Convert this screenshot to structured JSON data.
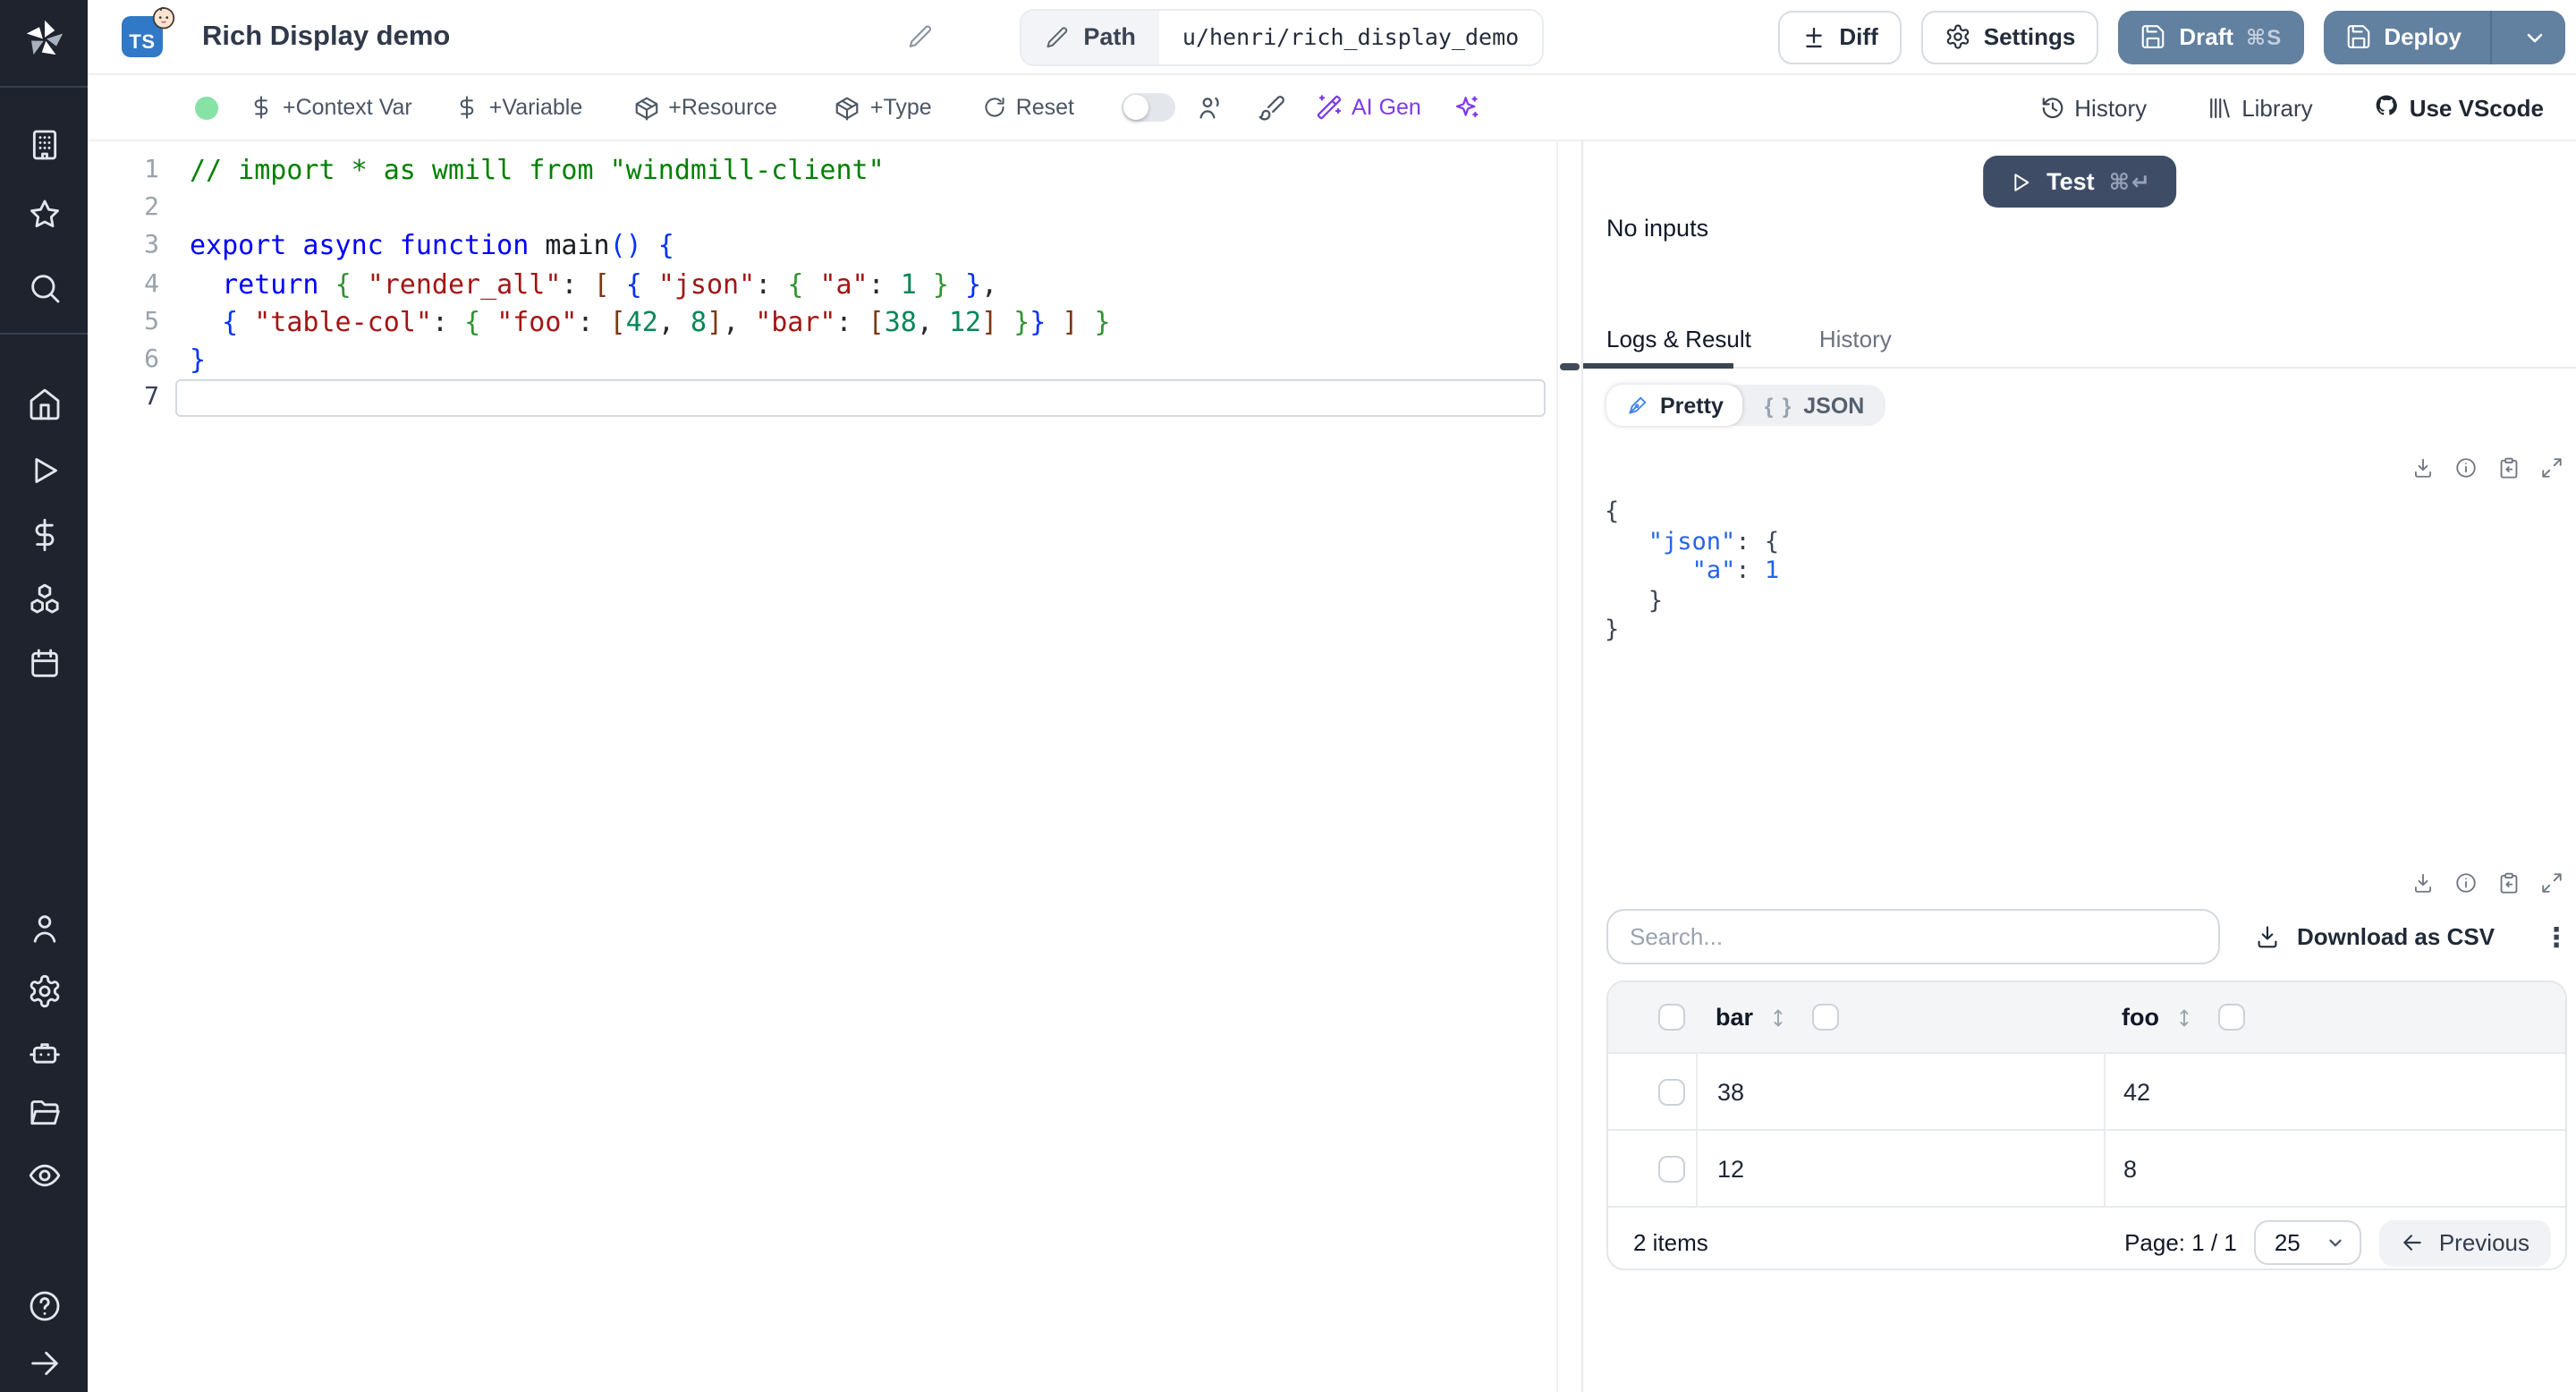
{
  "header": {
    "title": "Rich Display demo",
    "lang_badge": "TS",
    "path": {
      "label": "Path",
      "value": "u/henri/rich_display_demo"
    },
    "buttons": {
      "diff": "Diff",
      "settings": "Settings",
      "draft": "Draft",
      "draft_shortcut": "⌘S",
      "deploy": "Deploy"
    }
  },
  "toolbar": {
    "status_color": "#86e3a5",
    "context_var": "+Context Var",
    "variable": "+Variable",
    "resource": "+Resource",
    "type": "+Type",
    "reset": "Reset",
    "ai_gen": "AI Gen",
    "ai_color": "#7c3aed",
    "history": "History",
    "library": "Library",
    "vscode": "Use VScode"
  },
  "sidebar": {
    "icons": [
      "windmill-logo",
      "building",
      "star",
      "search",
      "home",
      "play",
      "dollar",
      "cubes",
      "calendar",
      "user",
      "gear",
      "bot",
      "folder",
      "eye",
      "help-circle",
      "arrow-right"
    ]
  },
  "editor": {
    "lines": [
      {
        "n": "1",
        "cur": false,
        "tokens": [
          {
            "t": "// import * as wmill from \"windmill-client\"",
            "c": "com"
          }
        ]
      },
      {
        "n": "2",
        "cur": false,
        "tokens": []
      },
      {
        "n": "3",
        "cur": false,
        "tokens": [
          {
            "t": "export async function ",
            "c": "kw"
          },
          {
            "t": "main",
            "c": "fn"
          },
          {
            "t": "() {",
            "c": "b1"
          }
        ]
      },
      {
        "n": "4",
        "cur": false,
        "tokens": [
          {
            "t": "  ",
            "c": "pl"
          },
          {
            "t": "return",
            "c": "kw"
          },
          {
            "t": " ",
            "c": "pl"
          },
          {
            "t": "{ ",
            "c": "b2"
          },
          {
            "t": "\"render_all\"",
            "c": "str"
          },
          {
            "t": ": ",
            "c": "pl"
          },
          {
            "t": "[ ",
            "c": "b3"
          },
          {
            "t": "{ ",
            "c": "b1"
          },
          {
            "t": "\"json\"",
            "c": "str"
          },
          {
            "t": ": ",
            "c": "pl"
          },
          {
            "t": "{ ",
            "c": "b2"
          },
          {
            "t": "\"a\"",
            "c": "str"
          },
          {
            "t": ": ",
            "c": "pl"
          },
          {
            "t": "1",
            "c": "num"
          },
          {
            "t": " }",
            "c": "b2"
          },
          {
            "t": " }",
            "c": "b1"
          },
          {
            "t": ",",
            "c": "pl"
          }
        ]
      },
      {
        "n": "5",
        "cur": false,
        "tokens": [
          {
            "t": "  ",
            "c": "pl"
          },
          {
            "t": "{ ",
            "c": "b1"
          },
          {
            "t": "\"table-col\"",
            "c": "str"
          },
          {
            "t": ": ",
            "c": "pl"
          },
          {
            "t": "{ ",
            "c": "b2"
          },
          {
            "t": "\"foo\"",
            "c": "str"
          },
          {
            "t": ": ",
            "c": "pl"
          },
          {
            "t": "[",
            "c": "b3"
          },
          {
            "t": "42",
            "c": "num"
          },
          {
            "t": ", ",
            "c": "pl"
          },
          {
            "t": "8",
            "c": "num"
          },
          {
            "t": "]",
            "c": "b3"
          },
          {
            "t": ", ",
            "c": "pl"
          },
          {
            "t": "\"bar\"",
            "c": "str"
          },
          {
            "t": ": ",
            "c": "pl"
          },
          {
            "t": "[",
            "c": "b3"
          },
          {
            "t": "38",
            "c": "num"
          },
          {
            "t": ", ",
            "c": "pl"
          },
          {
            "t": "12",
            "c": "num"
          },
          {
            "t": "]",
            "c": "b3"
          },
          {
            "t": " ",
            "c": "pl"
          },
          {
            "t": "}",
            "c": "b2"
          },
          {
            "t": "}",
            "c": "b1"
          },
          {
            "t": " ",
            "c": "pl"
          },
          {
            "t": "]",
            "c": "b3"
          },
          {
            "t": " ",
            "c": "pl"
          },
          {
            "t": "}",
            "c": "b2"
          }
        ]
      },
      {
        "n": "6",
        "cur": false,
        "tokens": [
          {
            "t": "}",
            "c": "b1"
          }
        ]
      },
      {
        "n": "7",
        "cur": true,
        "tokens": []
      }
    ]
  },
  "panel": {
    "test": {
      "label": "Test",
      "shortcut": "⌘↵"
    },
    "no_inputs": "No inputs",
    "tabs": [
      {
        "label": "Logs & Result"
      },
      {
        "label": "History"
      }
    ],
    "view_toggle": [
      {
        "label": "Pretty"
      },
      {
        "label": "JSON"
      }
    ],
    "result_json": [
      [
        {
          "t": "{",
          "c": "jp"
        }
      ],
      [
        {
          "t": "   ",
          "c": "jp"
        },
        {
          "t": "\"json\"",
          "c": "jk"
        },
        {
          "t": ": ",
          "c": "jp"
        },
        {
          "t": "{",
          "c": "jp"
        }
      ],
      [
        {
          "t": "      ",
          "c": "jp"
        },
        {
          "t": "\"a\"",
          "c": "jk"
        },
        {
          "t": ": ",
          "c": "jp"
        },
        {
          "t": "1",
          "c": "jv"
        }
      ],
      [
        {
          "t": "   }",
          "c": "jp"
        }
      ],
      [
        {
          "t": "}",
          "c": "jp"
        }
      ]
    ],
    "search_placeholder": "Search...",
    "download_csv": "Download as CSV",
    "table": {
      "columns": [
        "bar",
        "foo"
      ],
      "rows": [
        [
          "38",
          "42"
        ],
        [
          "12",
          "8"
        ]
      ]
    },
    "footer": {
      "items": "2 items",
      "page": "Page: 1 / 1",
      "page_size": "25",
      "previous": "Previous"
    }
  }
}
